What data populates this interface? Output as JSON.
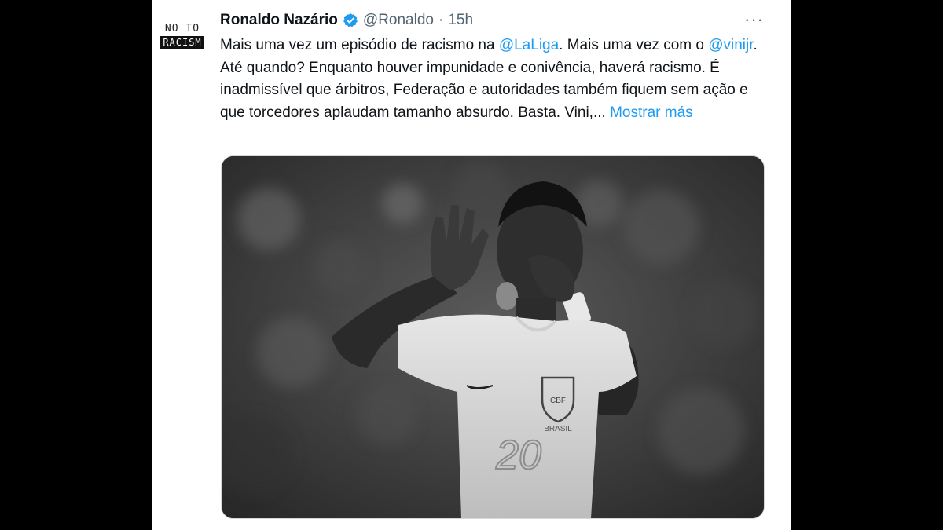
{
  "tweet": {
    "avatar": {
      "line1": "NO TO",
      "line2": "RACISM"
    },
    "author_name": "Ronaldo Nazário",
    "handle": "@Ronaldo",
    "separator": "·",
    "time": "15h",
    "more_icon": "···",
    "text": {
      "part1": "Mais uma vez um episódio de racismo na ",
      "mention1": "@LaLiga",
      "part2": ". Mais uma vez com o ",
      "mention2": "@vinijr",
      "part3": ". Até quando? Enquanto houver impunidade e conivência, haverá racismo. É inadmissível que árbitros, Federação e autoridades também fiquem sem ação e que torcedores aplaudam tamanho absurdo. Basta. Vini,... ",
      "show_more": "Mostrar más"
    },
    "media": {
      "jersey_text": "BRASIL",
      "jersey_crest": "CBF",
      "jersey_number": "20"
    }
  },
  "colors": {
    "link": "#1d9bf0",
    "text": "#0f1419",
    "secondary": "#536471",
    "background": "#000000"
  },
  "icons": {
    "verified": "verified-badge-icon",
    "more": "more-options-icon"
  }
}
